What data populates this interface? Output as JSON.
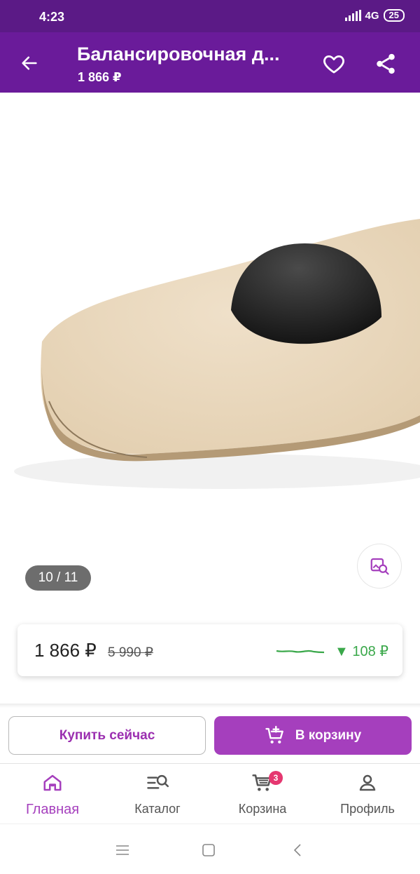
{
  "status_bar": {
    "time": "4:23",
    "network": "4G",
    "battery": "25"
  },
  "app_bar": {
    "title": "Балансировочная д...",
    "subtitle": "1 866 ₽"
  },
  "gallery": {
    "counter": "10 / 11"
  },
  "price_card": {
    "current_price": "1 866 ₽",
    "old_price": "5 990 ₽",
    "price_drop": "▼ 108 ₽",
    "trend_color": "#3aa84a"
  },
  "actions": {
    "buy_now_label": "Купить сейчас",
    "add_to_cart_label": "В корзину"
  },
  "bottom_nav": {
    "items": [
      {
        "label": "Главная",
        "icon": "home-icon",
        "active": true
      },
      {
        "label": "Каталог",
        "icon": "catalog-search-icon",
        "active": false
      },
      {
        "label": "Корзина",
        "icon": "cart-icon",
        "active": false,
        "badge": "3"
      },
      {
        "label": "Профиль",
        "icon": "profile-icon",
        "active": false
      }
    ]
  },
  "colors": {
    "brand": "#6a1b9a",
    "accent": "#a53fbd",
    "badge": "#e53770"
  }
}
